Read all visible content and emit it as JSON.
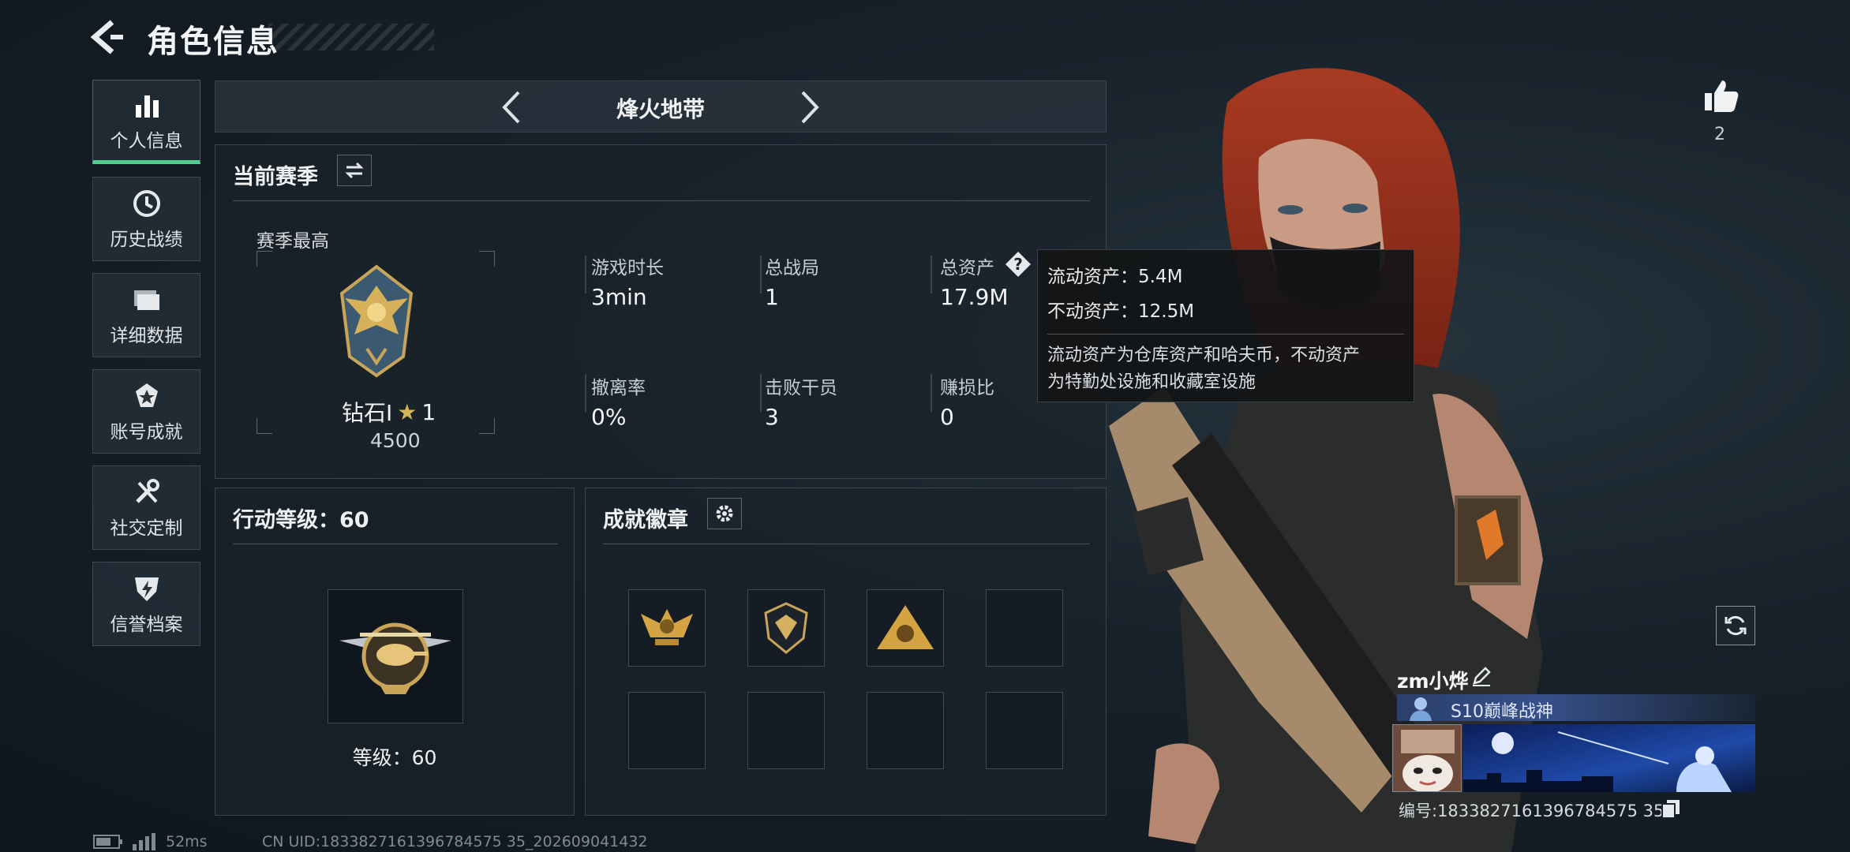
{
  "header": {
    "title": "角色信息",
    "back_icon": "back-arrow-icon"
  },
  "sidebar": {
    "items": [
      {
        "label": "个人信息",
        "icon": "bar-chart-icon",
        "active": true
      },
      {
        "label": "历史战绩",
        "icon": "clock-icon",
        "active": false
      },
      {
        "label": "详细数据",
        "icon": "folder-icon",
        "active": false
      },
      {
        "label": "账号成就",
        "icon": "medal-icon",
        "active": false
      },
      {
        "label": "社交定制",
        "icon": "tools-icon",
        "active": false
      },
      {
        "label": "信誉档案",
        "icon": "shield-bolt-icon",
        "active": false
      }
    ]
  },
  "mode_tabs": {
    "current": "烽火地带"
  },
  "season": {
    "title": "当前赛季",
    "best_label": "赛季最高",
    "rank_name": "钻石Ⅰ",
    "rank_stars": "1",
    "rank_score": "4500",
    "stats": [
      {
        "label": "游戏时长",
        "value": "3min"
      },
      {
        "label": "总战局",
        "value": "1"
      },
      {
        "label": "总资产",
        "value": "17.9M"
      },
      {
        "label": "撤离率",
        "value": "0%"
      },
      {
        "label": "击败干员",
        "value": "3"
      },
      {
        "label": "赚损比",
        "value": "0"
      }
    ]
  },
  "tooltip": {
    "liquid": "流动资产：5.4M",
    "fixed": "不动资产：12.5M",
    "desc_line1": "流动资产为仓库资产和哈夫币，不动资产",
    "desc_line2": "为特勤处设施和收藏室设施"
  },
  "action_level": {
    "title": "行动等级：60",
    "label": "等级：60"
  },
  "achievements": {
    "title": "成就徽章",
    "slots": [
      "eagle-badge",
      "gem-badge",
      "bear-badge",
      "",
      "",
      "",
      "",
      ""
    ]
  },
  "profile": {
    "likes": "2",
    "name": "zm小烨",
    "season_title": "S10巅峰战神",
    "id_label": "编号:1833827161396784575 35"
  },
  "footer": {
    "ping": "52ms",
    "uid": "CN UID:1833827161396784575 35_202609041432"
  },
  "colors": {
    "accent_green": "#4fd08e",
    "gold": "#d7a94b",
    "panel": "#1a222a"
  }
}
